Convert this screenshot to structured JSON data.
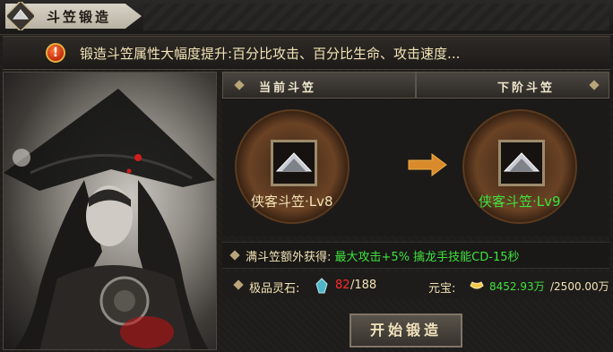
{
  "window": {
    "title": "斗笠锻造"
  },
  "notice": {
    "text": "锻造斗笠属性大幅度提升:百分比攻击、百分比生命、攻击速度..."
  },
  "current": {
    "header": "当前斗笠",
    "item_name": "侠客斗笠·Lv8"
  },
  "next": {
    "header": "下阶斗笠",
    "item_name": "侠客斗笠·Lv9"
  },
  "bonus": {
    "label": "满斗笠额外获得:",
    "value": "最大攻击+5%  擒龙手技能CD-15秒"
  },
  "resources": {
    "stone_label": "极品灵石:",
    "stone_have": "82",
    "stone_need": "/188",
    "gold_label": "元宝:",
    "gold_have": "8452.93万",
    "gold_need": "/2500.00万"
  },
  "forge_button": "开始锻造",
  "colors": {
    "green": "#3fe23f",
    "red": "#ff2a2a",
    "cream": "#f3e3b5"
  }
}
